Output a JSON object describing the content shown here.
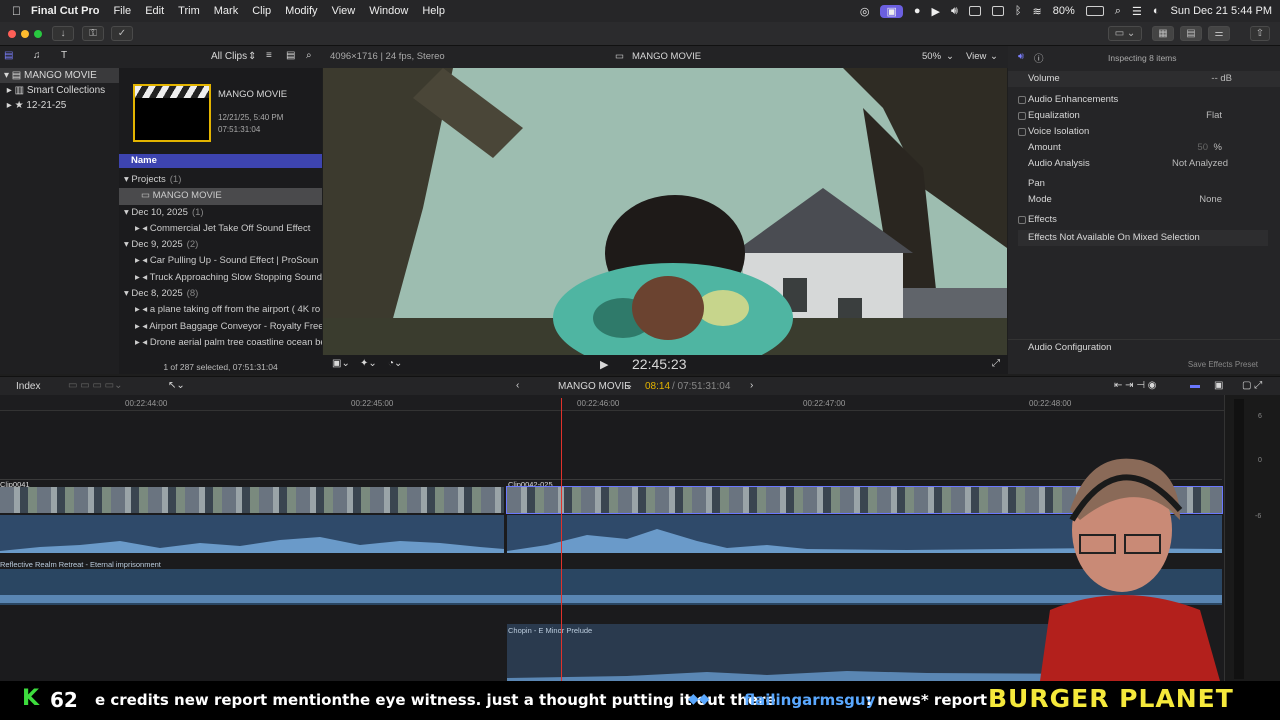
{
  "menubar": {
    "app": "Final Cut Pro",
    "items": [
      "File",
      "Edit",
      "Trim",
      "Mark",
      "Clip",
      "Modify",
      "View",
      "Window",
      "Help"
    ],
    "battery": "80%",
    "datetime": "Sun Dec 21  5:44 PM"
  },
  "browser": {
    "filter": "All Clips",
    "library": "MANGO MOVIE",
    "library_items": [
      "Smart Collections",
      "12-21-25"
    ],
    "thumb": {
      "title": "MANGO MOVIE",
      "date": "12/21/25, 5:40 PM",
      "duration": "07:51:31:04"
    },
    "column": "Name",
    "rows": [
      {
        "t": "grp",
        "label": "Projects",
        "count": "(1)"
      },
      {
        "t": "sel",
        "label": "MANGO MOVIE"
      },
      {
        "t": "grp",
        "label": "Dec 10, 2025",
        "count": "(1)"
      },
      {
        "t": "item",
        "label": "Commercial Jet Take Off Sound Effect"
      },
      {
        "t": "grp",
        "label": "Dec 9, 2025",
        "count": "(2)"
      },
      {
        "t": "item",
        "label": "Car Pulling Up - Sound Effect  |  ProSoun"
      },
      {
        "t": "item",
        "label": "Truck Approaching Slow Stopping Sound"
      },
      {
        "t": "grp",
        "label": "Dec 8, 2025",
        "count": "(8)"
      },
      {
        "t": "item",
        "label": "a plane taking off from the airport ( 4K ro"
      },
      {
        "t": "item",
        "label": "Airport Baggage Conveyor - Royalty Free"
      },
      {
        "t": "item",
        "label": "Drone aerial palm tree coastline ocean be"
      }
    ],
    "status": "1 of 287 selected, 07:51:31:04"
  },
  "viewer": {
    "format": "4096×1716 | 24 fps, Stereo",
    "project": "MANGO MOVIE",
    "zoom": "50%",
    "view": "View",
    "timecode": "22:45:23"
  },
  "inspector": {
    "header": "Inspecting 8 items",
    "volume_label": "Volume",
    "volume_value": "-- dB",
    "enh": "Audio Enhancements",
    "eq_label": "Equalization",
    "eq_value": "Flat",
    "vi_label": "Voice Isolation",
    "amount_label": "Amount",
    "amount_value": "50",
    "amount_unit": "%",
    "analysis_label": "Audio Analysis",
    "analysis_value": "Not Analyzed",
    "pan": "Pan",
    "mode_label": "Mode",
    "mode_value": "None",
    "effects": "Effects",
    "effects_msg": "Effects Not Available On Mixed Selection",
    "config": "Audio Configuration",
    "save": "Save Effects Preset"
  },
  "timeline": {
    "index": "Index",
    "project": "MANGO MOVIE",
    "position": "08:14",
    "duration": "/ 07:51:31:04",
    "ruler": [
      "00:22:44:00",
      "00:22:45:00",
      "00:22:46:00",
      "00:22:47:00",
      "00:22:48:00"
    ],
    "clip1": "Clip0041",
    "clip2": "Clip0042-025",
    "audio1": "Reflective Realm Retreat - Eternal imprisonment",
    "audio2": "Chopin - E Minor Prelude",
    "meter_ticks": [
      "6",
      "0",
      "-6"
    ]
  },
  "ticker": {
    "k": "K",
    "count": "62",
    "message": "e credits new report mentionthe eye witness. just a thought putting it out there",
    "user": "flailingarmsguy",
    "msg2": ": news* report",
    "brand": "BURGER PLANET"
  },
  "colors": {
    "accent": "#3d44b0",
    "playhead": "#e0322b",
    "brand": "#f5e93b",
    "ticker_user": "#5aa8ff",
    "k": "#3ddc3d"
  }
}
